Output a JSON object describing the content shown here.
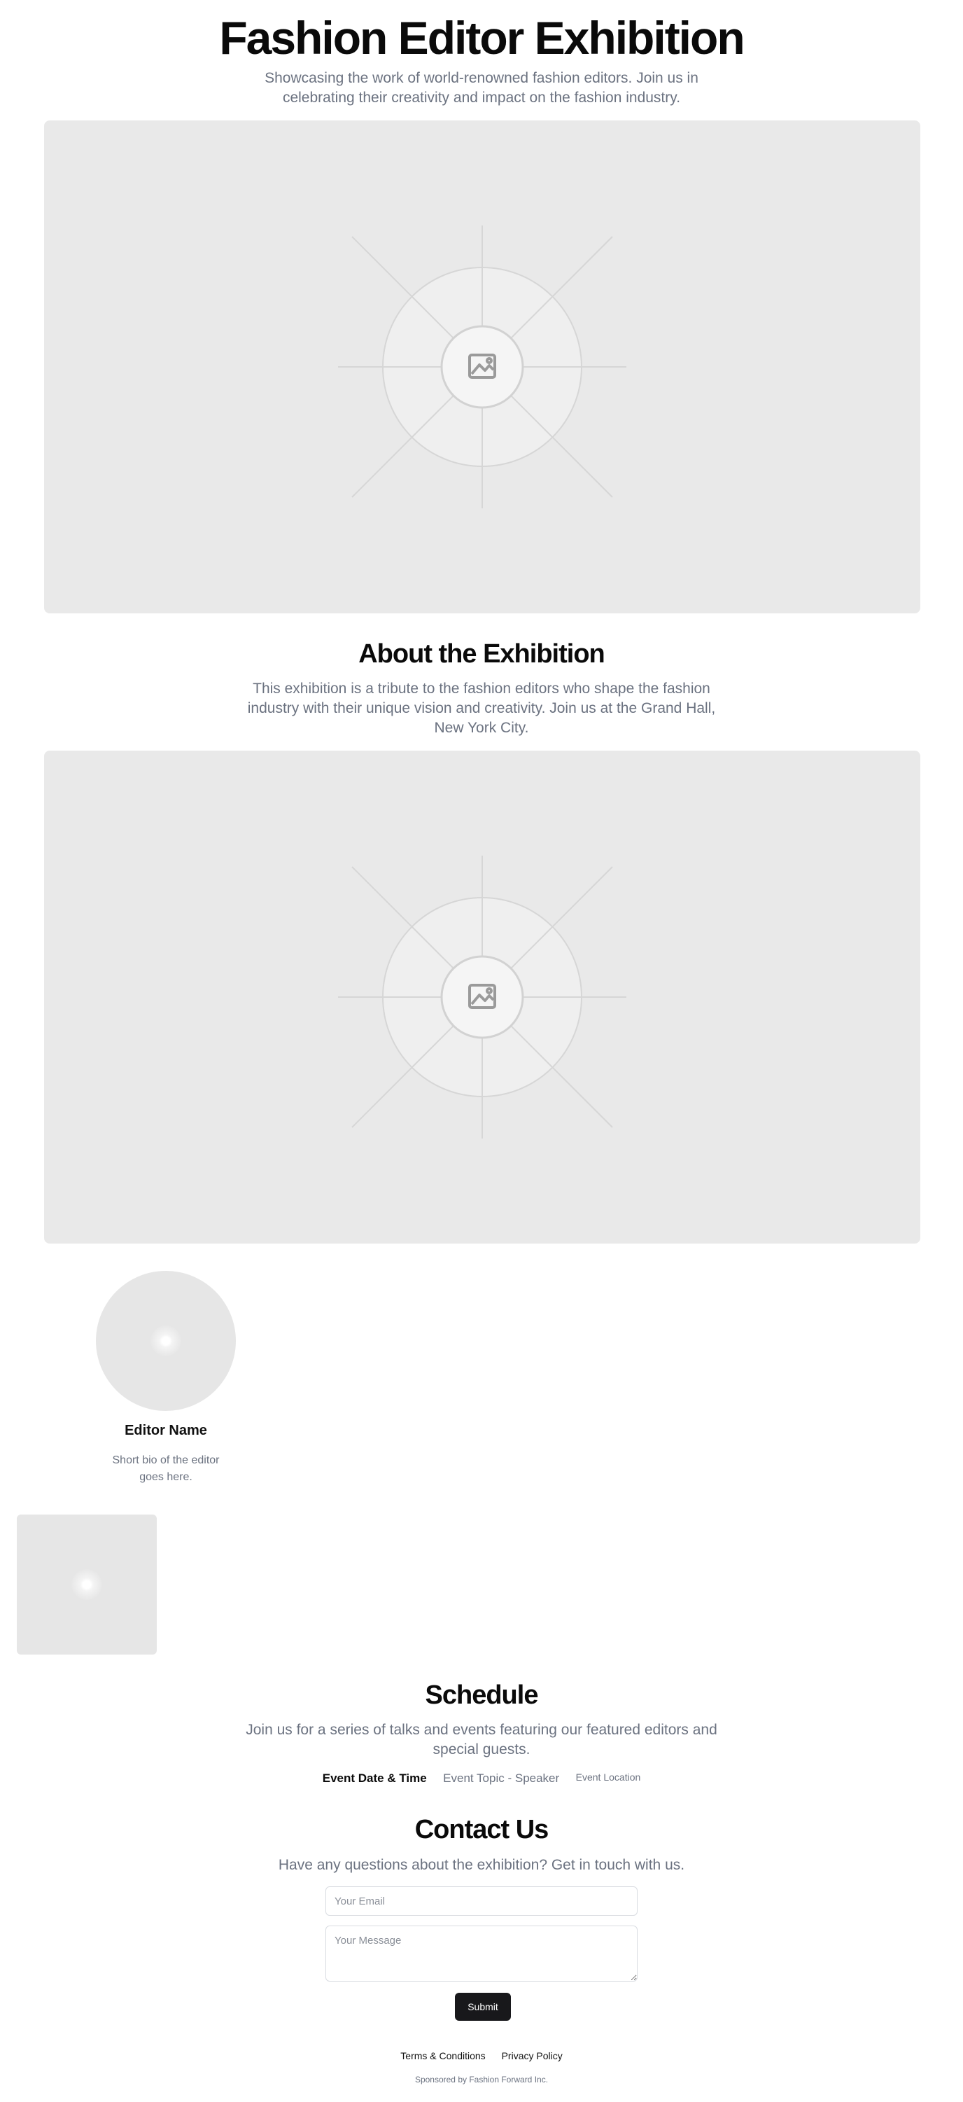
{
  "hero": {
    "title": "Fashion Editor Exhibition",
    "subtitle": "Showcasing the work of world-renowned fashion editors. Join us in celebrating their creativity and impact on the fashion industry."
  },
  "about": {
    "title": "About the Exhibition",
    "text": "This exhibition is a tribute to the fashion editors who shape the fashion industry with their unique vision and creativity. Join us at the Grand Hall, New York City."
  },
  "editor": {
    "name": "Editor Name",
    "bio": "Short bio of the editor goes here."
  },
  "schedule": {
    "title": "Schedule",
    "text": "Join us for a series of talks and events featuring our featured editors and special guests.",
    "event": {
      "date_time": "Event Date & Time",
      "topic": "Event Topic - Speaker",
      "location": "Event Location"
    }
  },
  "contact": {
    "title": "Contact Us",
    "text": "Have any questions about the exhibition? Get in touch with us.",
    "email_placeholder": "Your Email",
    "message_placeholder": "Your Message",
    "submit_label": "Submit"
  },
  "footer": {
    "terms": "Terms & Conditions",
    "privacy": "Privacy Policy",
    "sponsor": "Sponsored by Fashion Forward Inc."
  },
  "icons": {
    "placeholder": "image-icon"
  }
}
